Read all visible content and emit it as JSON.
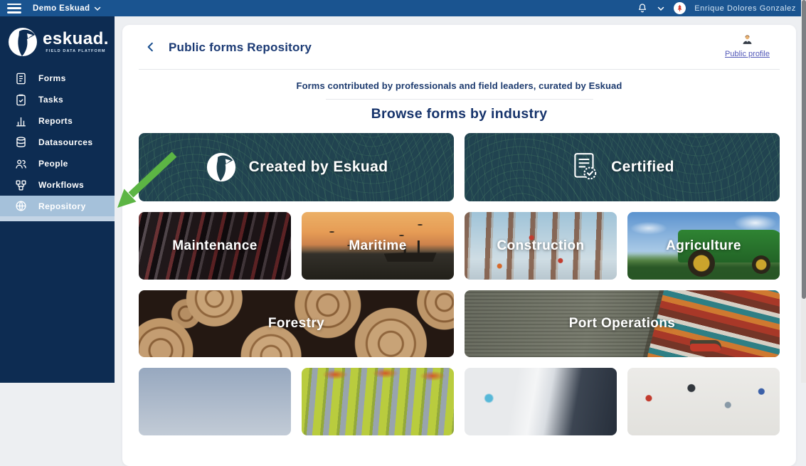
{
  "topbar": {
    "org_label": "Demo Eskuad",
    "user_name": "Enrique Dolores Gonzalez"
  },
  "sidebar": {
    "logo_text": "eskuad.",
    "logo_tagline": "Field Data Platform",
    "items": [
      {
        "label": "Forms",
        "icon": "document-icon",
        "active": false
      },
      {
        "label": "Tasks",
        "icon": "clipboard-check-icon",
        "active": false
      },
      {
        "label": "Reports",
        "icon": "bar-chart-icon",
        "active": false
      },
      {
        "label": "Datasources",
        "icon": "database-icon",
        "active": false
      },
      {
        "label": "People",
        "icon": "people-icon",
        "active": false
      },
      {
        "label": "Workflows",
        "icon": "workflow-icon",
        "active": false
      },
      {
        "label": "Repository",
        "icon": "globe-icon",
        "active": true
      }
    ]
  },
  "header": {
    "title": "Public forms Repository",
    "back_icon": "chevron-left-icon",
    "profile_icon": "person-bust-icon",
    "profile_link_label": "Public profile"
  },
  "intro": {
    "subtitle": "Forms contributed by professionals and field leaders, curated by Eskuad",
    "heading": "Browse forms by industry"
  },
  "categories": {
    "featured": [
      {
        "label": "Created by Eskuad",
        "icon": "eskuad-bird-icon"
      },
      {
        "label": "Certified",
        "icon": "certificate-badge-icon"
      }
    ],
    "industries": [
      {
        "label": "Maintenance"
      },
      {
        "label": "Maritime"
      },
      {
        "label": "Construction"
      },
      {
        "label": "Agriculture"
      }
    ],
    "wide_industries": [
      {
        "label": "Forestry"
      },
      {
        "label": "Port Operations"
      }
    ]
  },
  "annotation": {
    "arrow_color": "#5cb544"
  },
  "colors": {
    "topbar_blue": "#1a5490",
    "sidebar_navy": "#0d2c52",
    "active_item_blue": "#a5c1da",
    "heading_navy": "#1b3a74",
    "topo_card_teal": "#214350",
    "profile_link_blue": "#5157b8"
  }
}
